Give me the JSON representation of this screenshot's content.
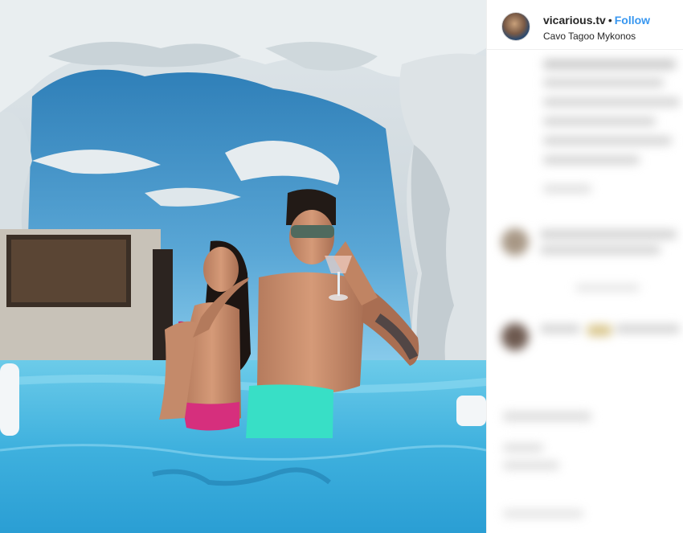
{
  "post": {
    "username": "vicarious.tv",
    "separator": "•",
    "follow_label": "Follow",
    "location": "Cavo Tagoo Mykonos"
  },
  "icons": {
    "avatar": "profile-photo"
  },
  "colors": {
    "follow": "#3897f0",
    "text": "#262626",
    "pool": "#4fb4dc",
    "cave": "#e4e7ea"
  }
}
